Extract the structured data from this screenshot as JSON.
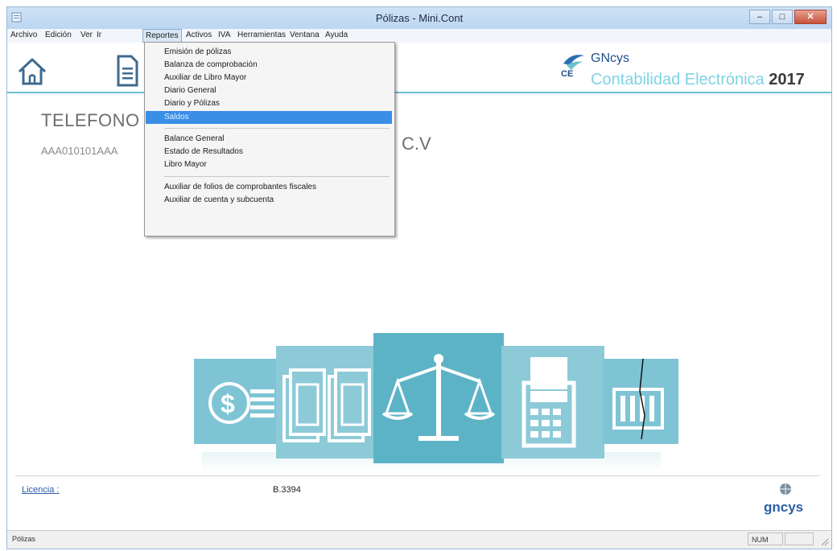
{
  "window": {
    "title": "Pólizas - Mini.Cont",
    "buttons": {
      "minimize": "–",
      "maximize": "□",
      "close": "✕"
    }
  },
  "menubar": {
    "items": [
      "Archivo",
      "Edición",
      "Ver",
      "Ir",
      "Reportes",
      "Activos",
      "IVA",
      "Herramientas",
      "Ventana",
      "Ayuda"
    ],
    "active": "Reportes"
  },
  "reportes_menu": {
    "items": [
      "Emisión de pólizas",
      "Balanza de comprobación",
      "Auxiliar de Libro Mayor",
      "Diario General",
      "Diario y Pólizas",
      "Saldos",
      "Balance General",
      "Estado de Resultados",
      "Libro Mayor",
      "Auxiliar de folios de comprobantes fiscales",
      "Auxiliar de cuenta y subcuenta"
    ],
    "selected": "Saldos"
  },
  "brand": {
    "logo_text": "CE",
    "name": "GNcys",
    "tagline": "Contabilidad Electrónica",
    "year": "2017"
  },
  "company": {
    "name_visible": "TELEFONO",
    "name_tail": "C.V",
    "rfc_visible": "AAA010101AAA"
  },
  "footer": {
    "licencia_label": "Licencia :",
    "licencia_value": "B.3394",
    "logo_text": "gncys"
  },
  "statusbar": {
    "left": "Pólizas",
    "num": "NUM"
  },
  "icons": [
    "home-icon",
    "document-icon",
    "money-icon",
    "papers-icon",
    "balance-scale-icon",
    "calculator-icon",
    "building-icon"
  ],
  "colors": {
    "accent": "#6bc0cd",
    "card": "#7fc4d4",
    "card_dark": "#5db3c6",
    "selection": "#3a8ee6",
    "link": "#2a5aa8"
  }
}
